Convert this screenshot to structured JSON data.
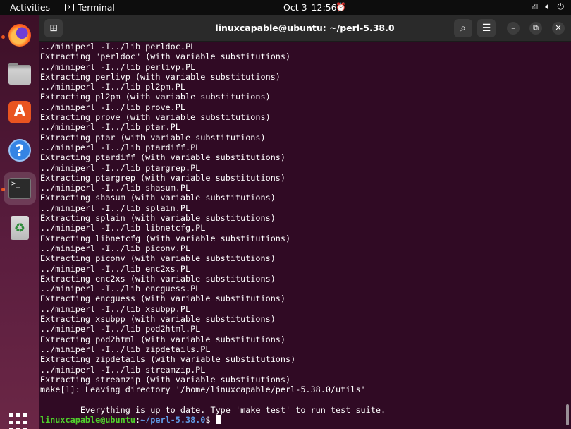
{
  "topbar": {
    "activities": "Activities",
    "app_name": "Terminal",
    "date": "Oct 3",
    "time": "12:56"
  },
  "dock": {
    "items": [
      {
        "name": "firefox",
        "icon": "firefox-icon"
      },
      {
        "name": "files",
        "icon": "files-icon"
      },
      {
        "name": "app-center",
        "icon": "app-store-icon",
        "glyph": "A"
      },
      {
        "name": "help",
        "icon": "help-icon",
        "glyph": "?"
      },
      {
        "name": "terminal",
        "icon": "terminal-icon",
        "glyph": ">_"
      },
      {
        "name": "trash",
        "icon": "trash-icon",
        "glyph": "♻"
      }
    ],
    "apps_grid": "show-apps-icon"
  },
  "window": {
    "title": "linuxcapable@ubuntu: ~/perl-5.38.0"
  },
  "terminal": {
    "lines": [
      "../miniperl -I../lib perldoc.PL",
      "Extracting \"perldoc\" (with variable substitutions)",
      "../miniperl -I../lib perlivp.PL",
      "Extracting perlivp (with variable substitutions)",
      "../miniperl -I../lib pl2pm.PL",
      "Extracting pl2pm (with variable substitutions)",
      "../miniperl -I../lib prove.PL",
      "Extracting prove (with variable substitutions)",
      "../miniperl -I../lib ptar.PL",
      "Extracting ptar (with variable substitutions)",
      "../miniperl -I../lib ptardiff.PL",
      "Extracting ptardiff (with variable substitutions)",
      "../miniperl -I../lib ptargrep.PL",
      "Extracting ptargrep (with variable substitutions)",
      "../miniperl -I../lib shasum.PL",
      "Extracting shasum (with variable substitutions)",
      "../miniperl -I../lib splain.PL",
      "Extracting splain (with variable substitutions)",
      "../miniperl -I../lib libnetcfg.PL",
      "Extracting libnetcfg (with variable substitutions)",
      "../miniperl -I../lib piconv.PL",
      "Extracting piconv (with variable substitutions)",
      "../miniperl -I../lib enc2xs.PL",
      "Extracting enc2xs (with variable substitutions)",
      "../miniperl -I../lib encguess.PL",
      "Extracting encguess (with variable substitutions)",
      "../miniperl -I../lib xsubpp.PL",
      "Extracting xsubpp (with variable substitutions)",
      "../miniperl -I../lib pod2html.PL",
      "Extracting pod2html (with variable substitutions)",
      "../miniperl -I../lib zipdetails.PL",
      "Extracting zipdetails (with variable substitutions)",
      "../miniperl -I../lib streamzip.PL",
      "Extracting streamzip (with variable substitutions)",
      "make[1]: Leaving directory '/home/linuxcapable/perl-5.38.0/utils'",
      "",
      "        Everything is up to date. Type 'make test' to run test suite."
    ],
    "prompt": {
      "user_host": "linuxcapable@ubuntu",
      "separator": ":",
      "path": "~/perl-5.38.0",
      "symbol": "$"
    }
  }
}
